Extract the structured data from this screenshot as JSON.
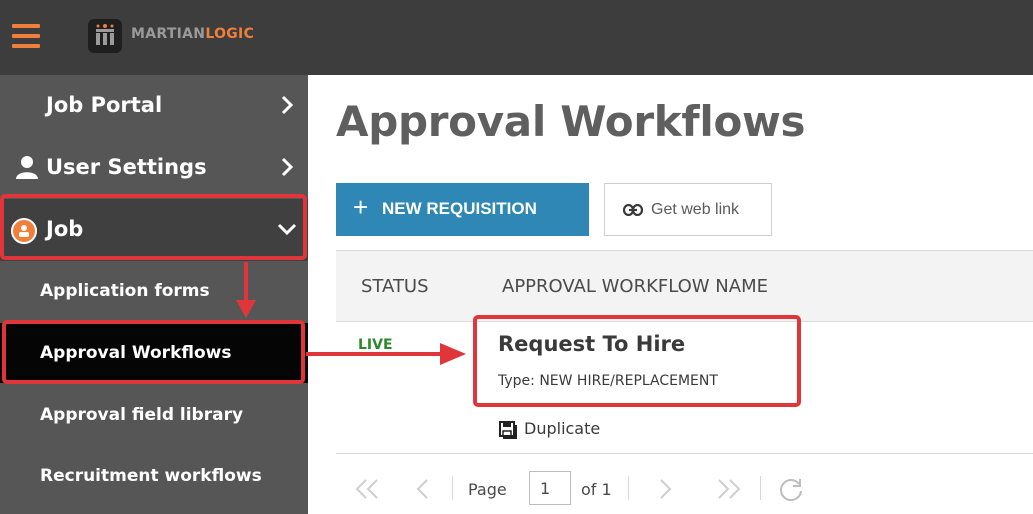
{
  "brand": {
    "name_part1": "MARTIAN",
    "name_part2": "LOGIC"
  },
  "sidebar": {
    "items": [
      {
        "label": "Job Portal"
      },
      {
        "label": "User Settings"
      },
      {
        "label": "Job"
      }
    ],
    "sub_items": [
      {
        "label": "Application forms"
      },
      {
        "label": "Approval Workflows"
      },
      {
        "label": "Approval field library"
      },
      {
        "label": "Recruitment workflows"
      }
    ]
  },
  "main": {
    "title": "Approval Workflows",
    "new_button": {
      "icon": "+",
      "label": "NEW REQUISITION"
    },
    "link_button": {
      "label": "Get web link"
    },
    "table": {
      "headers": [
        "STATUS",
        "APPROVAL WORKFLOW NAME"
      ],
      "rows": [
        {
          "status": "LIVE",
          "name": "Request To Hire",
          "type": "Type: NEW HIRE/REPLACEMENT",
          "action": "Duplicate"
        }
      ]
    },
    "pager": {
      "page_label": "Page",
      "current_page": "1",
      "of_label": "of 1"
    }
  },
  "colors": {
    "accent_orange": "#f07f3c",
    "primary_blue": "#2e87b5",
    "highlight_red": "#e0363b",
    "status_green": "#2b8a2b"
  }
}
